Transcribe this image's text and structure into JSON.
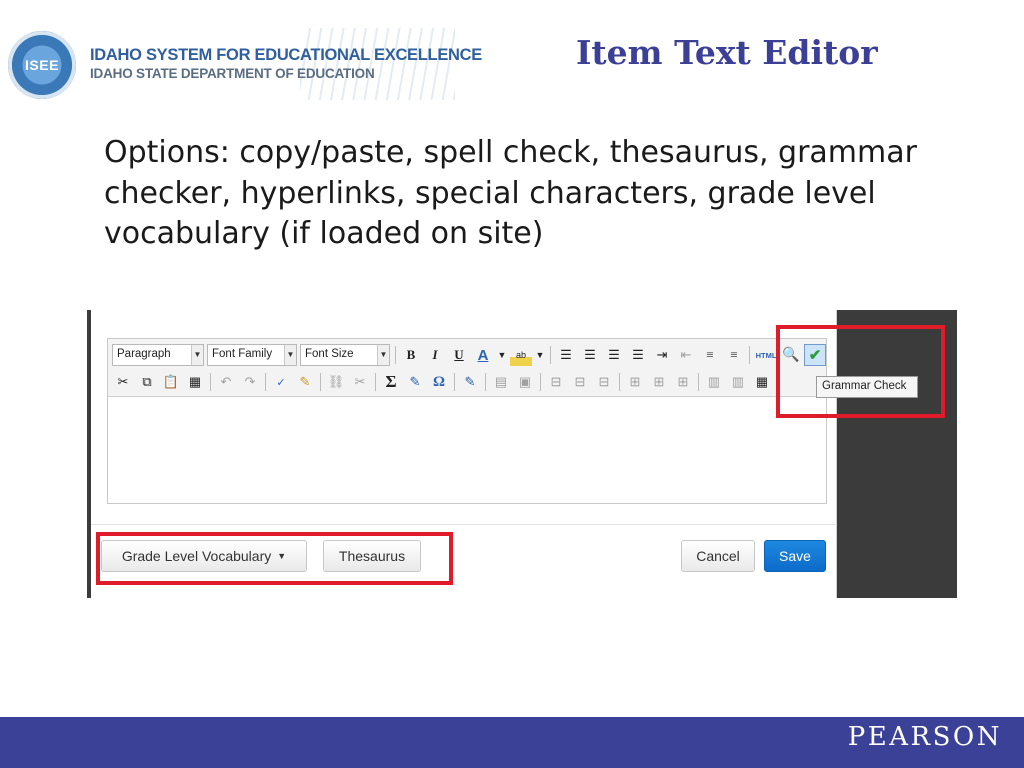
{
  "header": {
    "logo_seal_text": "ISEE",
    "logo_line1": "IDAHO SYSTEM FOR EDUCATIONAL EXCELLENCE",
    "logo_line2": "IDAHO STATE DEPARTMENT OF EDUCATION",
    "title": "Item Text Editor"
  },
  "body": {
    "text": "Options: copy/paste, spell check, thesaurus, grammar checker, hyperlinks, special characters, grade level vocabulary (if loaded on site)"
  },
  "editor": {
    "paragraph_select": "Paragraph",
    "font_family_select": "Font Family",
    "font_size_select": "Font Size",
    "bold_glyph": "B",
    "italic_glyph": "I",
    "underline_glyph": "U",
    "html_label": "HTML",
    "tooltip": "Grammar Check"
  },
  "footer": {
    "grade_level_button": "Grade Level Vocabulary",
    "thesaurus_button": "Thesaurus",
    "cancel_button": "Cancel",
    "save_button": "Save"
  },
  "brand": {
    "pearson": "PEARSON"
  },
  "colors": {
    "title": "#3b3f96",
    "highlight": "#e01b2a",
    "save": "#1a7fd6",
    "bottom_bar": "#3a4197"
  }
}
